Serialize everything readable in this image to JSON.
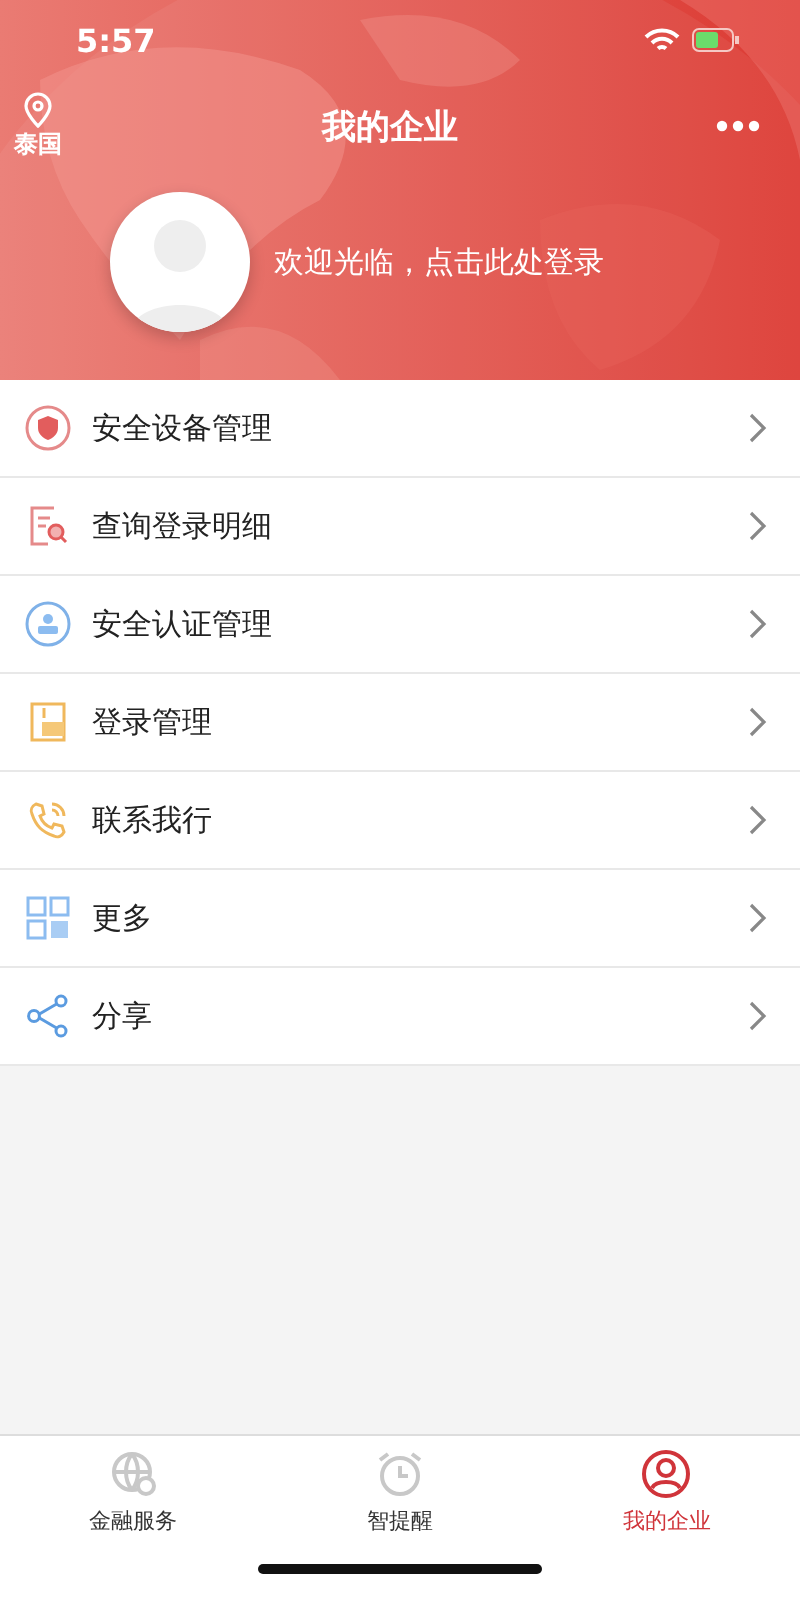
{
  "status_bar": {
    "time": "5:57"
  },
  "header": {
    "location": "泰国",
    "title": "我的企业",
    "welcome": "欢迎光临，点击此处登录"
  },
  "menu": [
    {
      "kind": "shield",
      "label": "安全设备管理"
    },
    {
      "kind": "record",
      "label": "查询登录明细"
    },
    {
      "kind": "auth",
      "label": "安全认证管理"
    },
    {
      "kind": "login",
      "label": "登录管理"
    },
    {
      "kind": "phone",
      "label": "联系我行"
    },
    {
      "kind": "grid",
      "label": "更多"
    },
    {
      "kind": "share",
      "label": "分享"
    }
  ],
  "tabs": [
    {
      "kind": "globe",
      "label": "金融服务",
      "selected": false
    },
    {
      "kind": "clock",
      "label": "智提醒",
      "selected": false
    },
    {
      "kind": "user",
      "label": "我的企业",
      "selected": true
    }
  ]
}
